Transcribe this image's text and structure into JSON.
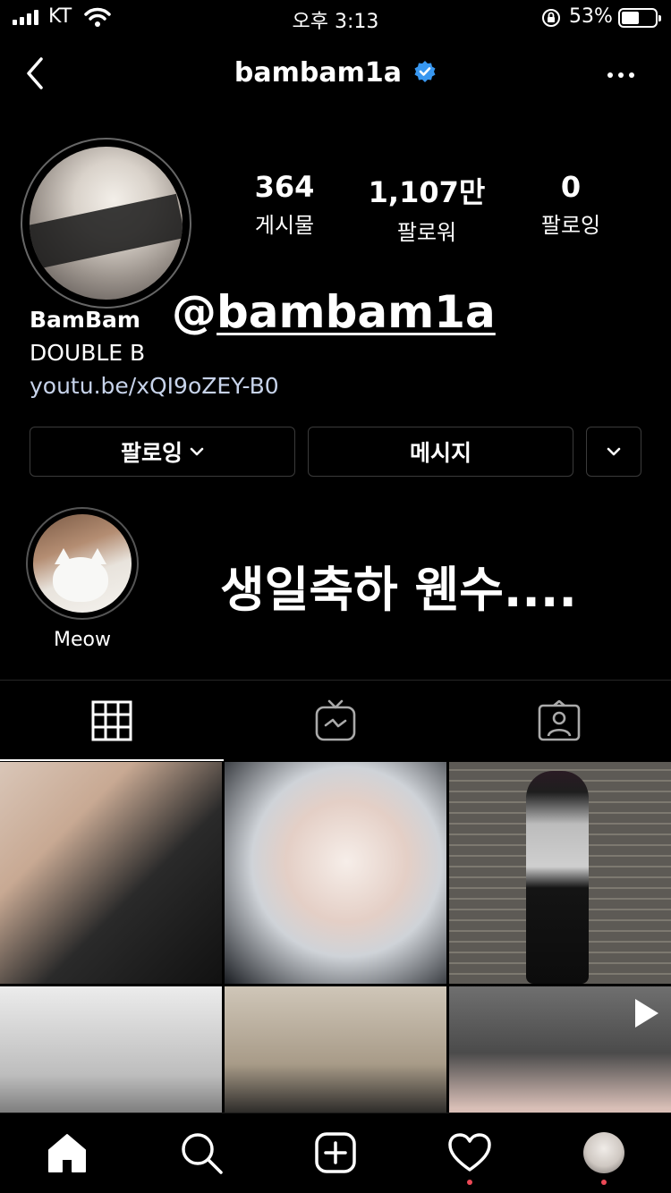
{
  "status_bar": {
    "carrier": "KT",
    "time": "오후 3:13",
    "battery_percent": "53%",
    "battery_level": 0.53
  },
  "header": {
    "username": "bambam1a",
    "verified": true,
    "back_icon": "chevron-left-icon",
    "more_icon": "ellipsis-icon"
  },
  "profile": {
    "stats": [
      {
        "value": "364",
        "label": "게시물"
      },
      {
        "value": "1,107만",
        "label": "팔로워"
      },
      {
        "value": "0",
        "label": "팔로잉"
      }
    ],
    "display_name": "BamBam",
    "bio": "DOUBLE B",
    "link": "youtu.be/xQI9oZEY-B0",
    "overlay_handle_at": "@",
    "overlay_handle": "bambam1a"
  },
  "actions": {
    "following": "팔로잉",
    "message": "메시지"
  },
  "highlight": {
    "label": "Meow"
  },
  "caption_overlay": "생일축하 웬수....",
  "tabs": [
    "grid-icon",
    "igtv-icon",
    "tagged-icon"
  ],
  "bottom_nav": [
    "home-icon",
    "search-icon",
    "add-post-icon",
    "heart-icon",
    "profile-avatar"
  ],
  "colors": {
    "background": "#000000",
    "verified": "#3897f0",
    "link": "#c7d3ea",
    "notification_dot": "#ed4956"
  }
}
